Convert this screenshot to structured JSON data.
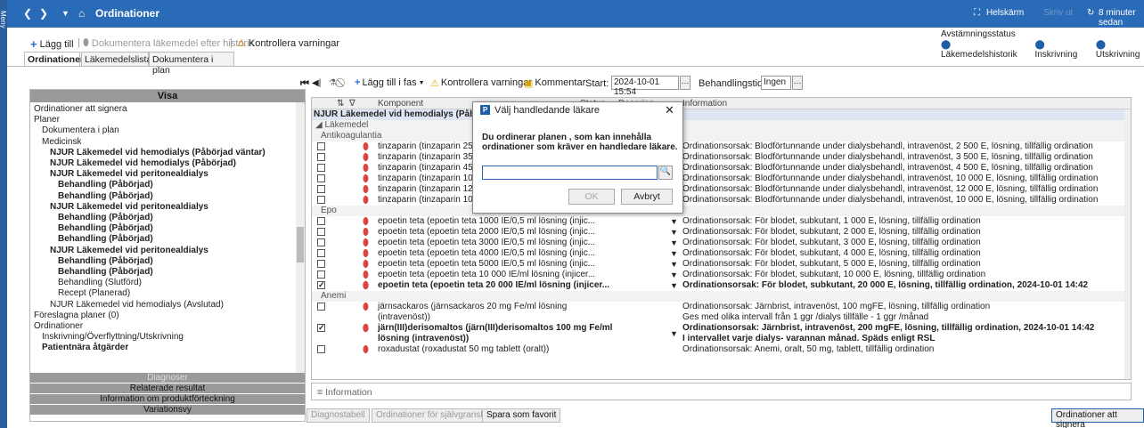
{
  "titlebar": {
    "title": "Ordinationer",
    "fullscreen": "Helskärm",
    "saved": "Skriv ut",
    "time": "8 minuter sedan"
  },
  "leftbar": {
    "label": "Meny"
  },
  "toolbar": {
    "add": "Lägg till",
    "document_history": "Dokumentera läkemedel efter historik",
    "check_warnings": "Kontrollera varningar"
  },
  "status": {
    "title": "Avstämningsstatus",
    "items": [
      "Läkemedelshistorik",
      "Inskrivning",
      "Utskrivning"
    ]
  },
  "tabs": [
    "Ordinationer",
    "Läkemedelslista",
    "Dokumentera i plan"
  ],
  "leftpanel": {
    "header": "Visa",
    "tree": [
      {
        "label": "Ordinationer att signera",
        "indent": 0,
        "bold": false
      },
      {
        "label": "Planer",
        "indent": 0,
        "bold": false
      },
      {
        "label": "Dokumentera i plan",
        "indent": 1,
        "bold": false
      },
      {
        "label": "Medicinsk",
        "indent": 1,
        "bold": false
      },
      {
        "label": "NJUR Läkemedel vid hemodialys (Påbörjad väntar)",
        "indent": 2,
        "bold": true
      },
      {
        "label": "NJUR Läkemedel vid hemodialys (Påbörjad)",
        "indent": 2,
        "bold": true
      },
      {
        "label": "NJUR Läkemedel vid peritonealdialys",
        "indent": 2,
        "bold": true
      },
      {
        "label": "Behandling (Påbörjad)",
        "indent": 3,
        "bold": true
      },
      {
        "label": "Behandling (Påbörjad)",
        "indent": 3,
        "bold": true
      },
      {
        "label": "NJUR Läkemedel vid peritonealdialys",
        "indent": 2,
        "bold": true
      },
      {
        "label": "Behandling (Påbörjad)",
        "indent": 3,
        "bold": true
      },
      {
        "label": "Behandling (Påbörjad)",
        "indent": 3,
        "bold": true
      },
      {
        "label": "Behandling (Påbörjad)",
        "indent": 3,
        "bold": true
      },
      {
        "label": "NJUR Läkemedel vid peritonealdialys",
        "indent": 2,
        "bold": true
      },
      {
        "label": "Behandling (Påbörjad)",
        "indent": 3,
        "bold": true
      },
      {
        "label": "Behandling (Påbörjad)",
        "indent": 3,
        "bold": true
      },
      {
        "label": "Behandling (Slutförd)",
        "indent": 3,
        "bold": false
      },
      {
        "label": "Recept (Planerad)",
        "indent": 3,
        "bold": false
      },
      {
        "label": "NJUR Läkemedel vid hemodialys (Avslutad)",
        "indent": 2,
        "bold": false
      },
      {
        "label": "Föreslagna planer (0)",
        "indent": 0,
        "bold": false
      },
      {
        "label": "Ordinationer",
        "indent": 0,
        "bold": false
      },
      {
        "label": "Inskrivning/Överflyttning/Utskrivning",
        "indent": 1,
        "bold": false
      },
      {
        "label": "Patientnära åtgärder",
        "indent": 1,
        "bold": true
      }
    ],
    "footer": [
      "Diagnoser",
      "Relaterade resultat",
      "Information om produktförteckning",
      "Variationsvy"
    ]
  },
  "rtoolbar": {
    "add_phase": "Lägg till i fas",
    "check_warnings": "Kontrollera varningar",
    "comment": "Kommentar",
    "start_label": "Start:",
    "start_value": "2024-10-01 15:54",
    "duration_label": "Behandlingstid:",
    "duration_value": "Ingen"
  },
  "grid": {
    "columns": [
      "Komponent",
      "Status",
      "Dosering",
      "Information"
    ],
    "plan_title": "NJUR Läkemedel vid hemodialys (Påbörjad väntar)",
    "section": "Läkemedel",
    "rows": [
      {
        "type": "sub",
        "label": "Antikoagulantia"
      },
      {
        "type": "item",
        "comp": "tinzaparin (tinzaparin 2500 an",
        "info": "Ordinationsorsak: Blodförtunnande under dialysbehandl, intravenöst, 2 500 E, lösning, tillfällig ordination",
        "checked": false,
        "bold": false
      },
      {
        "type": "item",
        "comp": "tinzaparin (tinzaparin 3500 an",
        "info": "Ordinationsorsak: Blodförtunnande under dialysbehandl, intravenöst, 3 500 E, lösning, tillfällig ordination",
        "checked": false,
        "bold": false
      },
      {
        "type": "item",
        "comp": "tinzaparin (tinzaparin 4500 an",
        "info": "Ordinationsorsak: Blodförtunnande under dialysbehandl, intravenöst, 4 500 E, lösning, tillfällig ordination",
        "checked": false,
        "bold": false
      },
      {
        "type": "item",
        "comp": "tinzaparin (tinzaparin 10 000 a",
        "info": "Ordinationsorsak: Blodförtunnande under dialysbehandl, intravenöst, 10 000 E, lösning, tillfällig ordination",
        "checked": false,
        "bold": false
      },
      {
        "type": "item",
        "comp": "tinzaparin (tinzaparin 12 000 a",
        "info": "Ordinationsorsak: Blodförtunnande under dialysbehandl, intravenöst, 12 000 E, lösning, tillfällig ordination",
        "checked": false,
        "bold": false
      },
      {
        "type": "item",
        "comp": "tinzaparin (tinzaparin 10 000 a",
        "info": "Ordinationsorsak: Blodförtunnande under dialysbehandl, intravenöst, 10 000 E, lösning, tillfällig ordination",
        "checked": false,
        "bold": false
      },
      {
        "type": "sub",
        "label": "Epo"
      },
      {
        "type": "item",
        "comp": "epoetin teta (epoetin teta 1000 IE/0,5 ml lösning (injic...",
        "info": "Ordinationsorsak: För blodet, subkutant, 1 000 E, lösning, tillfällig ordination",
        "checked": false,
        "bold": false,
        "dd": true
      },
      {
        "type": "item",
        "comp": "epoetin teta (epoetin teta 2000 IE/0,5 ml lösning (injic...",
        "info": "Ordinationsorsak: För blodet, subkutant, 2 000 E, lösning, tillfällig ordination",
        "checked": false,
        "bold": false,
        "dd": true
      },
      {
        "type": "item",
        "comp": "epoetin teta (epoetin teta 3000 IE/0,5 ml lösning (injic...",
        "info": "Ordinationsorsak: För blodet, subkutant, 3 000 E, lösning, tillfällig ordination",
        "checked": false,
        "bold": false,
        "dd": true
      },
      {
        "type": "item",
        "comp": "epoetin teta (epoetin teta 4000 IE/0,5 ml lösning (injic...",
        "info": "Ordinationsorsak: För blodet, subkutant, 4 000 E, lösning, tillfällig ordination",
        "checked": false,
        "bold": false,
        "dd": true
      },
      {
        "type": "item",
        "comp": "epoetin teta (epoetin teta 5000 IE/0,5 ml lösning (injic...",
        "info": "Ordinationsorsak: För blodet, subkutant, 5 000 E, lösning, tillfällig ordination",
        "checked": false,
        "bold": false,
        "dd": true
      },
      {
        "type": "item",
        "comp": "epoetin teta (epoetin teta 10 000 IE/ml lösning (injicer...",
        "info": "Ordinationsorsak: För blodet, subkutant, 10 000 E, lösning, tillfällig ordination",
        "checked": false,
        "bold": false,
        "dd": true
      },
      {
        "type": "item",
        "comp": "epoetin teta (epoetin teta 20 000 IE/ml lösning (injicer...",
        "info": "Ordinationsorsak: För blodet, subkutant, 20 000 E, lösning, tillfällig ordination, 2024-10-01 14:42",
        "checked": true,
        "bold": true,
        "dd": true
      },
      {
        "type": "sub",
        "label": "Anemi"
      },
      {
        "type": "item2",
        "comp": "järnsackaros (järnsackaros 20 mg Fe/ml lösning",
        "comp2": "(intravenöst))",
        "info": "Ordinationsorsak: Järnbrist, intravenöst, 100 mgFE, lösning, tillfällig ordination",
        "info2": "Ges med olika intervall från 1 ggr /dialys tillfälle - 1 ggr /månad",
        "checked": false,
        "bold": false
      },
      {
        "type": "item2",
        "comp": "järn(III)derisomaltos (järn(III)derisomaltos 100 mg Fe/ml",
        "comp2": "lösning (intravenöst))",
        "info": "Ordinationsorsak: Järnbrist, intravenöst, 200 mgFE, lösning, tillfällig ordination, 2024-10-01 14:42",
        "info2": "I intervallet varje dialys- varannan månad. Späds enligt RSL",
        "checked": true,
        "bold": true,
        "dd": true
      },
      {
        "type": "item",
        "comp": "roxadustat (roxadustat 50 mg tablett (oralt))",
        "info": "Ordinationsorsak: Anemi, oralt, 50 mg, tablett, tillfällig ordination",
        "checked": false,
        "bold": false
      }
    ]
  },
  "infobar": {
    "label": "Information"
  },
  "bottom": {
    "b1": "Diagnostabell",
    "b2": "Ordinationer för självgranskning",
    "b3": "Spara som favorit",
    "b4": "Ordinationer att signera"
  },
  "dialog": {
    "icon_letter": "P",
    "title": "Välj handledande läkare",
    "message": "Du ordinerar planen , som kan innehålla ordinationer som kräver en handledare läkare.",
    "input_value": "",
    "ok": "OK",
    "cancel": "Avbryt"
  },
  "colors": {
    "titlebar": "#2a6bb8",
    "accent": "#1f5fa8"
  }
}
